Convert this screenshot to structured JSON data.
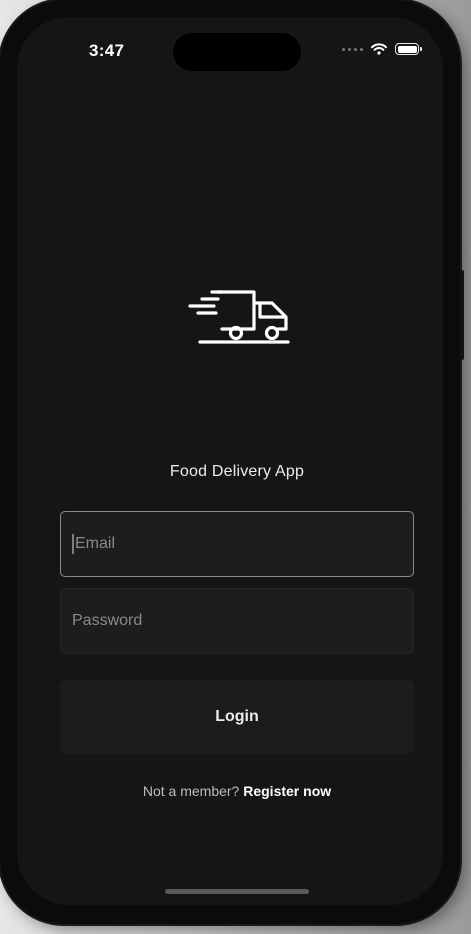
{
  "status_bar": {
    "time": "3:47",
    "icons": [
      "signal-dots-icon",
      "wifi-icon",
      "battery-icon"
    ]
  },
  "app": {
    "logo_icon": "delivery-truck-icon",
    "title": "Food Delivery App"
  },
  "form": {
    "email_placeholder": "Email",
    "password_placeholder": "Password",
    "login_label": "Login"
  },
  "footer": {
    "prompt": "Not a member?",
    "register_label": "Register now"
  },
  "colors": {
    "background": "#151515",
    "field_background": "#1d1d1d",
    "focused_border": "#8a8a8a",
    "text": "#ececec"
  }
}
